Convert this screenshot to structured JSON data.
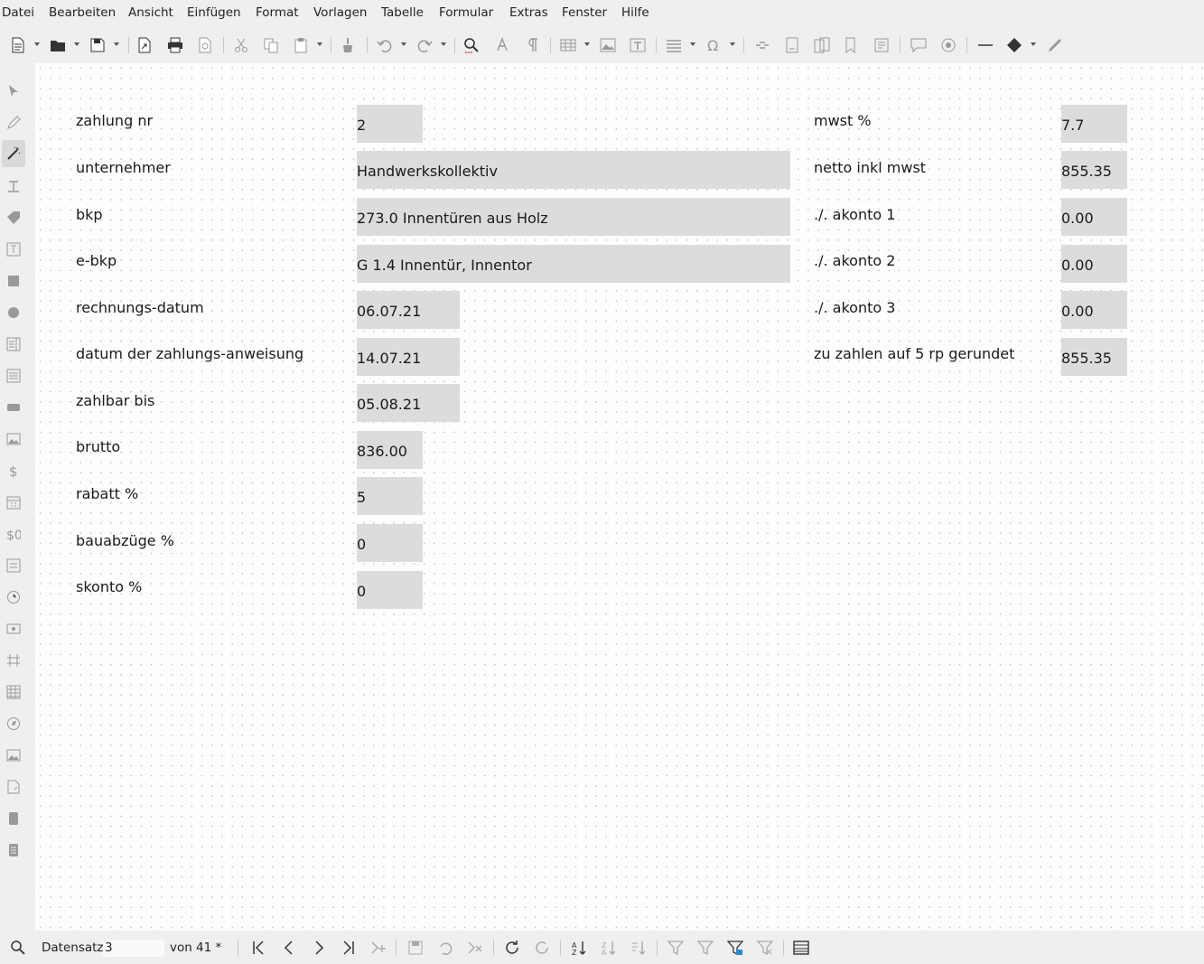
{
  "menu": [
    "Datei",
    "Bearbeiten",
    "Ansicht",
    "Einfügen",
    "Format",
    "Vorlagen",
    "Tabelle",
    "Formular",
    "Extras",
    "Fenster",
    "Hilfe"
  ],
  "form": {
    "left_rows": [
      {
        "label": "zahlung nr",
        "value": "2"
      },
      {
        "label": "unternehmer",
        "value": "Handwerkskollektiv"
      },
      {
        "label": "bkp",
        "value": "273.0 Innentüren aus Holz"
      },
      {
        "label": "e-bkp",
        "value": "G 1.4 Innentür, Innentor"
      },
      {
        "label": "rechnungs-datum",
        "value": "06.07.21"
      },
      {
        "label": "datum der zahlungs-anweisung",
        "value": "14.07.21"
      },
      {
        "label": "zahlbar bis",
        "value": "05.08.21"
      },
      {
        "label": "brutto",
        "value": "836.00"
      },
      {
        "label": "rabatt %",
        "value": "5"
      },
      {
        "label": "bauabzüge %",
        "value": "0"
      },
      {
        "label": "skonto %",
        "value": "0"
      }
    ],
    "right_rows": [
      {
        "label": "mwst %",
        "value": "7.7"
      },
      {
        "label": "netto inkl mwst",
        "value": "855.35"
      },
      {
        "label": "./. akonto 1",
        "value": "0.00"
      },
      {
        "label": "./. akonto 2",
        "value": "0.00"
      },
      {
        "label": "./. akonto 3",
        "value": "0.00"
      },
      {
        "label": "zu zahlen auf 5 rp gerundet",
        "value": "855.35"
      }
    ]
  },
  "navigation": {
    "record_label": "Datensatz",
    "record_value": "3",
    "of_label": "von",
    "total": "41 *"
  },
  "colors": {
    "field_bg": "#dcdcdc",
    "canvas_bg": "#fdfdfd",
    "ui_bg": "#efefef"
  }
}
